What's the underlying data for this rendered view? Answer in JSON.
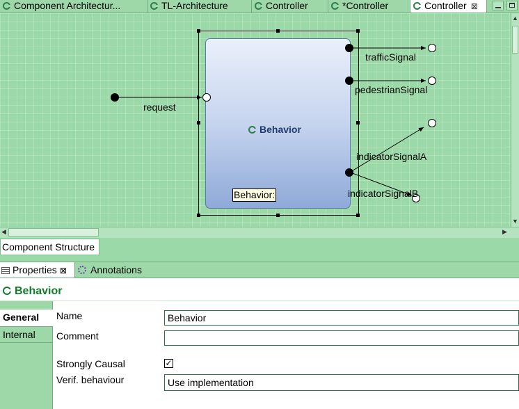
{
  "editor_tabs": [
    {
      "label": "Component Architectur...",
      "active": false,
      "dirty": false
    },
    {
      "label": "TL-Architecture",
      "active": false
    },
    {
      "label": "Controller",
      "active": false
    },
    {
      "label": "*Controller",
      "active": false
    },
    {
      "label": "Controller",
      "active": true,
      "close": "⊠"
    }
  ],
  "diagram": {
    "block_name": "Behavior",
    "tooltip": "Behavior:",
    "ports": {
      "input": "request",
      "outputs": [
        "trafficSignal",
        "pedestrianSignal",
        "indicatorSignalA",
        "indicatorSignalB"
      ]
    }
  },
  "structure_tab": "Component Structure",
  "properties_view": {
    "tabs": [
      {
        "label": "Properties",
        "close": "⊠",
        "icon": "properties-icon"
      },
      {
        "label": "Annotations",
        "icon": "annotations-icon"
      }
    ],
    "selection_title": "Behavior",
    "side_tabs": [
      "General",
      "Internal"
    ],
    "fields": {
      "name_label": "Name",
      "name_value": "Behavior",
      "comment_label": "Comment",
      "comment_value": "",
      "strongly_causal_label": "Strongly Causal",
      "strongly_causal_checked": true,
      "strongly_causal_mark": "✓",
      "verif_label": "Verif. behaviour",
      "verif_value": "Use implementation"
    }
  },
  "colors": {
    "background_green": "#9bd9a8",
    "block_blue": "#8eaad8",
    "title_green": "#147a2f"
  }
}
